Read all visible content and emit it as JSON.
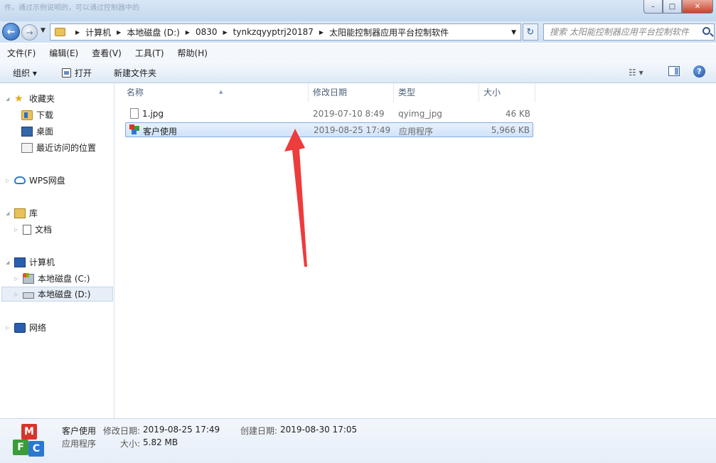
{
  "window": {
    "title": "件。通过示例说明的，可以通过控制器中的",
    "min": "–",
    "max": "□",
    "close": "✕"
  },
  "address": {
    "crumbs": [
      "计算机",
      "本地磁盘 (D:)",
      "0830",
      "tynkzqyyptrj20187",
      "太阳能控制器应用平台控制软件"
    ],
    "search_placeholder": "搜索 太阳能控制器应用平台控制软件"
  },
  "menu": [
    "文件(F)",
    "编辑(E)",
    "查看(V)",
    "工具(T)",
    "帮助(H)"
  ],
  "toolbar": {
    "organize": "组织 ▾",
    "open": "打开",
    "new_folder": "新建文件夹"
  },
  "nav": {
    "favorites": "收藏夹",
    "downloads": "下载",
    "desktop": "桌面",
    "recent": "最近访问的位置",
    "wps": "WPS网盘",
    "libraries": "库",
    "documents": "文档",
    "computer": "计算机",
    "c_drive": "本地磁盘 (C:)",
    "d_drive": "本地磁盘 (D:)",
    "network": "网络"
  },
  "columns": {
    "name": "名称",
    "date": "修改日期",
    "type": "类型",
    "size": "大小"
  },
  "files": [
    {
      "name": "1.jpg",
      "date": "2019-07-10 8:49",
      "type": "qyimg_jpg",
      "size": "46 KB"
    },
    {
      "name": "客户使用",
      "date": "2019-08-25 17:49",
      "type": "应用程序",
      "size": "5,966 KB"
    }
  ],
  "details": {
    "name": "客户使用",
    "type": "应用程序",
    "mod_label": "修改日期:",
    "mod_value": "2019-08-25 17:49",
    "create_label": "创建日期:",
    "create_value": "2019-08-30 17:05",
    "size_label": "大小:",
    "size_value": "5.82 MB"
  },
  "colors": {
    "accent": "#3399ff",
    "arrow": "#ee3b3b",
    "selection": "#cfe3fa"
  }
}
